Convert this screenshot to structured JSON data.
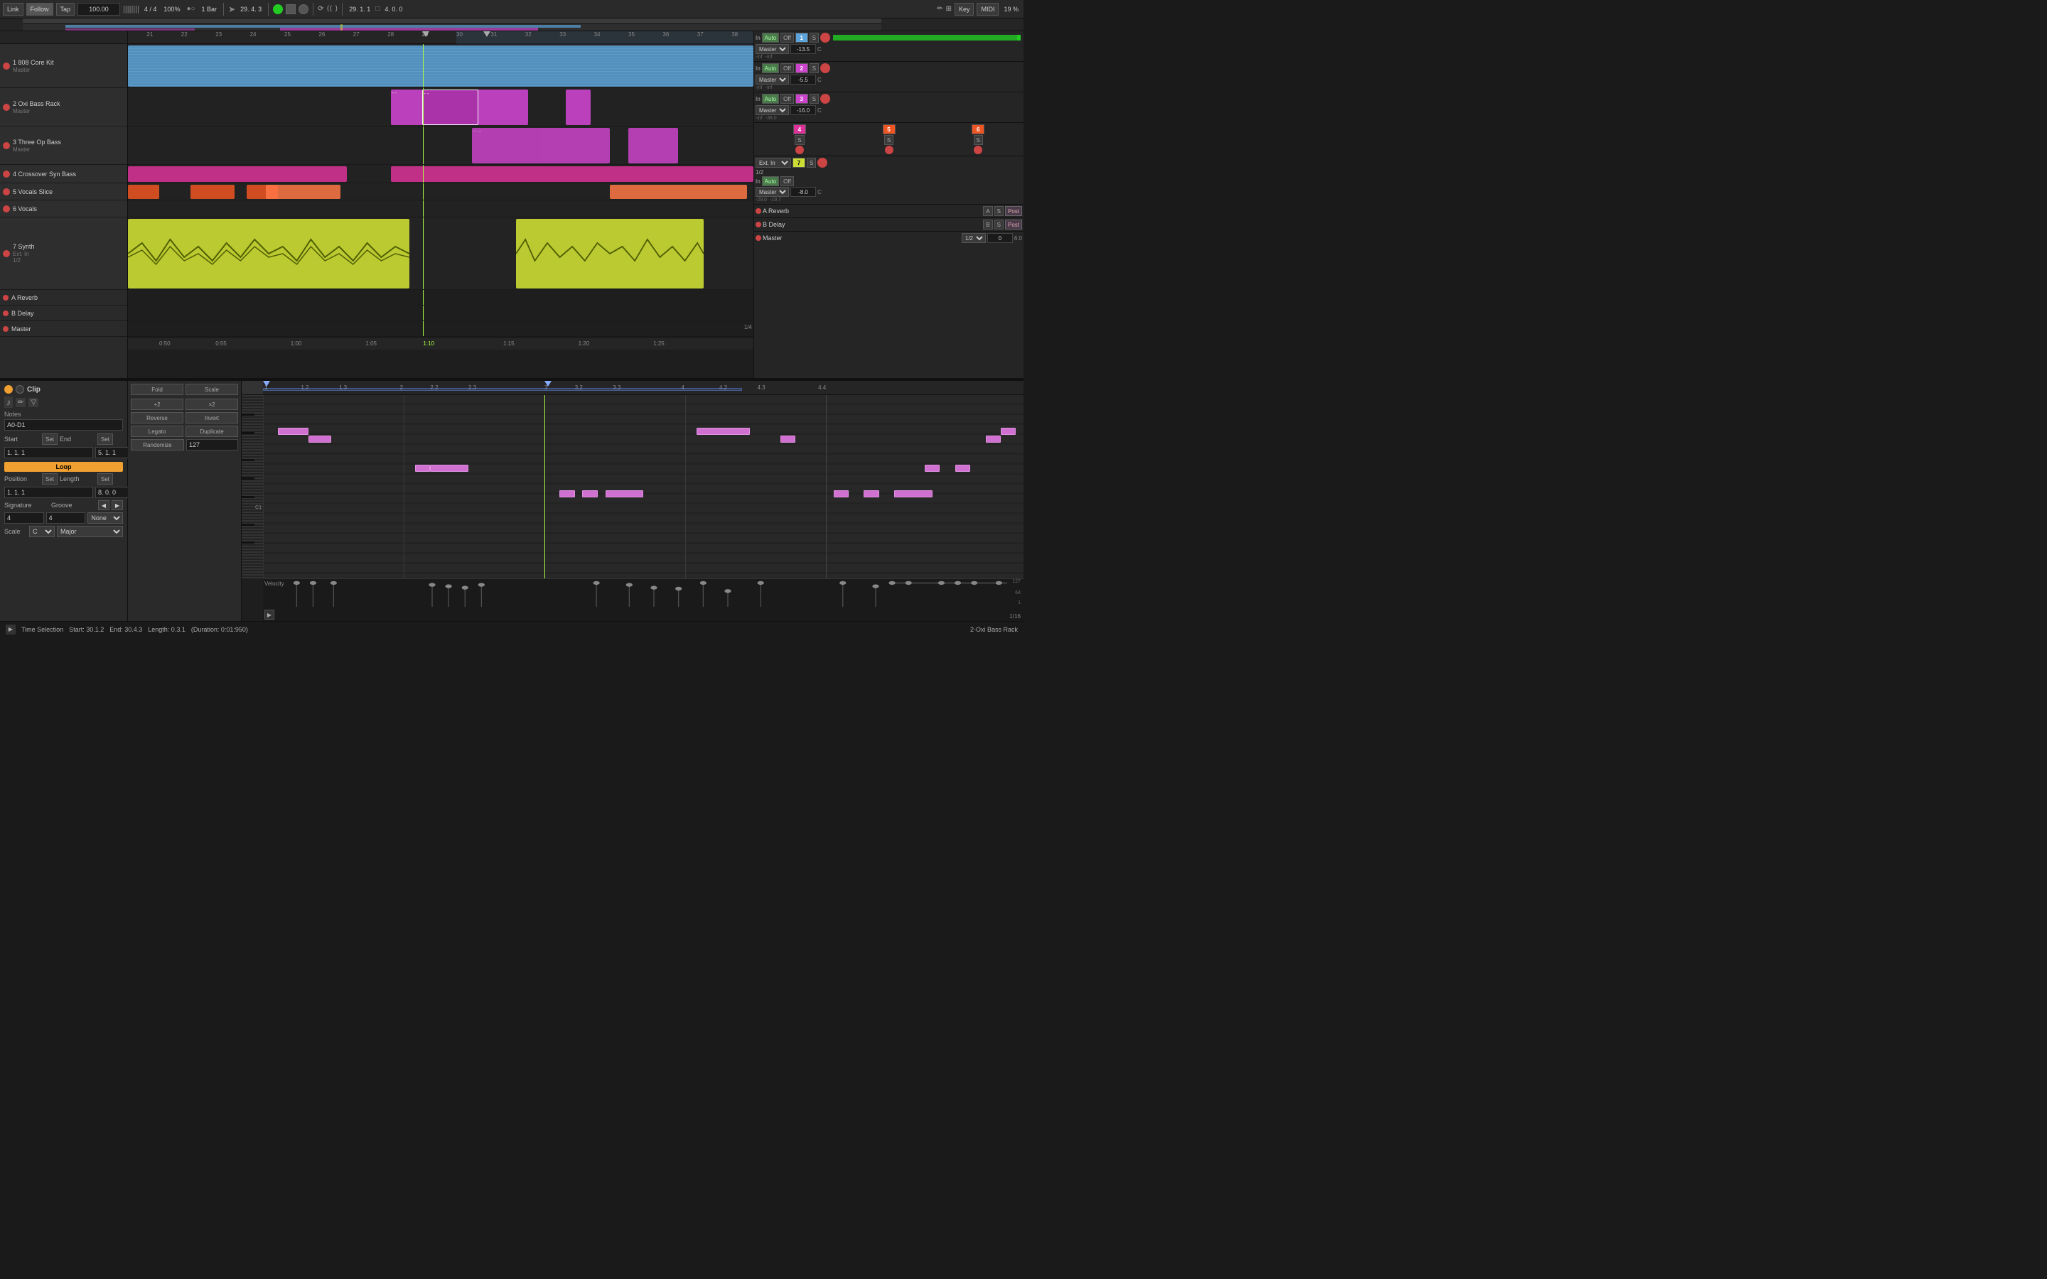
{
  "toolbar": {
    "link": "Link",
    "follow": "Follow",
    "tap": "Tap",
    "bpm": "100.00",
    "time_sig": "4 / 4",
    "zoom": "100%",
    "quantize": "1 Bar",
    "position": "29. 4. 3",
    "position2": "29. 1. 1",
    "position3": "4. 0. 0",
    "key": "Key",
    "midi": "MIDI",
    "cpu": "19 %"
  },
  "tracks": [
    {
      "id": 1,
      "name": "1 808 Core Kit",
      "color": "#5ba3d9",
      "height": 60
    },
    {
      "id": 2,
      "name": "2 Oxi Bass Rack",
      "color": "#cc44cc",
      "height": 52
    },
    {
      "id": 3,
      "name": "3 Three Op Bass",
      "color": "#cc44cc",
      "height": 52
    },
    {
      "id": 4,
      "name": "4 Crossover Syn Bass",
      "color": "#dd3399",
      "height": 24
    },
    {
      "id": 5,
      "name": "5 Vocals Slice",
      "color": "#ff6633",
      "height": 24
    },
    {
      "id": 6,
      "name": "6 Vocals",
      "color": "#ff6633",
      "height": 24
    },
    {
      "id": 7,
      "name": "7 Synth",
      "color": "#ccdd33",
      "height": 100
    }
  ],
  "mixer": {
    "tracks": [
      {
        "num": "1",
        "name": "808 Core",
        "in": "In",
        "auto": "Auto",
        "off": "Off",
        "fader": "-13.5",
        "pan": "C",
        "inf1": "-inf",
        "inf2": "-inf",
        "color": "#5ba3d9"
      },
      {
        "num": "2",
        "name": "Oxi Bass",
        "in": "In",
        "auto": "Auto",
        "off": "Off",
        "fader": "-5.5",
        "pan": "C",
        "inf1": "-inf",
        "inf2": "-inf",
        "color": "#cc44cc"
      },
      {
        "num": "3",
        "name": "Three Op",
        "in": "In",
        "auto": "Auto",
        "off": "Off",
        "fader": "-16.0",
        "pan": "C",
        "inf1": "-inf",
        "inf2": "-38.0",
        "color": "#cc44cc"
      },
      {
        "num": "4",
        "name": "Crossover",
        "color": "#dd3399"
      },
      {
        "num": "5",
        "name": "Vocals Slice",
        "color": "#ff6633"
      },
      {
        "num": "6",
        "name": "Vocals",
        "color": "#ff6633"
      },
      {
        "num": "7",
        "name": "Synth",
        "in": "Ext. In",
        "fader": "-8.0",
        "pan": "C",
        "inf": "-29.0",
        "inf2": "-19.7",
        "color": "#ccdd33"
      }
    ],
    "sends": [
      {
        "name": "A Reverb",
        "label": "A",
        "s": "S",
        "post": "Post"
      },
      {
        "name": "B Delay",
        "label": "B",
        "s": "S",
        "post": "Post"
      },
      {
        "name": "Master",
        "fader": "0",
        "pan": "6.0"
      }
    ]
  },
  "clip": {
    "title": "Clip",
    "start": "1. 1. 1",
    "end": "5. 1. 1",
    "loop": "Loop",
    "position": "1. 1. 1",
    "length": "8. 0. 0",
    "position_label": "Position",
    "length_label": "Length",
    "signature_label": "Signature",
    "groove_label": "Groove",
    "sig_num": "4",
    "sig_den": "4",
    "groove_val": "None",
    "scale_root": "C",
    "scale_type": "Major",
    "notes_range": "A0-D1",
    "div2": "+2",
    "mul2": "×2",
    "reverse": "Reverse",
    "invert": "Invert",
    "legato": "Legato",
    "duplicate": "Duplicate",
    "randomize": "Randomize",
    "rand_val": "127",
    "fold": "Fold",
    "scale_btn": "Scale"
  },
  "statusbar": {
    "type": "Time Selection",
    "start": "Start: 30.1.2",
    "end": "End: 30.4.3",
    "length": "Length: 0.3.1",
    "duration": "(Duration: 0:01:950)",
    "track": "2-Oxi Bass Rack"
  },
  "ruler_marks": [
    "21",
    "22",
    "23",
    "24",
    "25",
    "26",
    "27",
    "28",
    "29",
    "30",
    "31",
    "32",
    "33",
    "34",
    "35",
    "36",
    "37",
    "38"
  ],
  "piano_marks": [
    "1",
    "1.2",
    "1.3",
    "2",
    "2.2",
    "2.3",
    "3",
    "3.2",
    "3.3",
    "4",
    "4.2",
    "4.3",
    "4.4"
  ],
  "velocity_label": "Velocity",
  "velocity_marks": [
    "127",
    "64",
    "1"
  ],
  "fraction": "1/4",
  "fraction2": "1/16"
}
